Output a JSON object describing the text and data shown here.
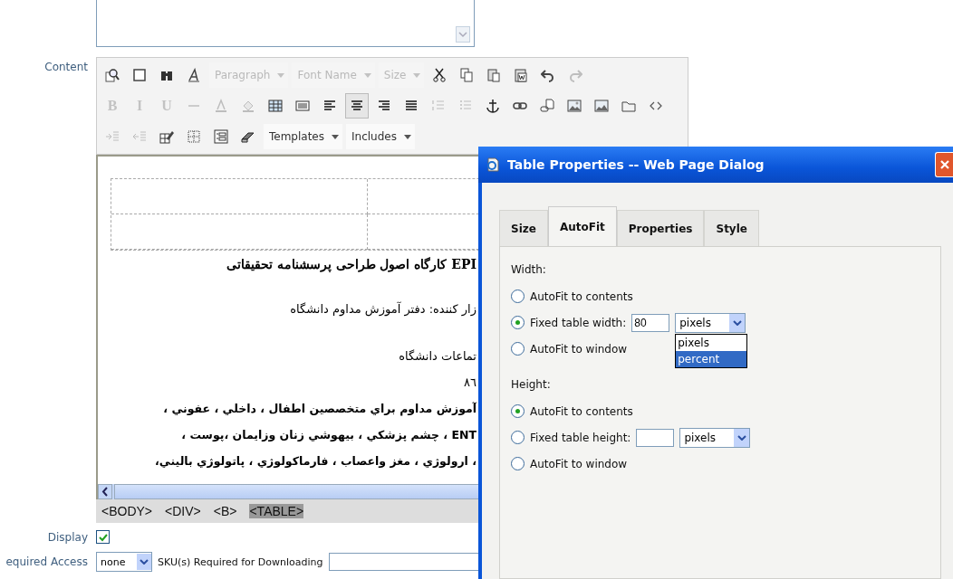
{
  "content_label": "Content",
  "toolbar": {
    "rows": [
      {
        "items": [
          {
            "kind": "button",
            "disabled": false
          },
          {
            "kind": "button",
            "disabled": false
          },
          {
            "kind": "button",
            "disabled": false
          },
          {
            "kind": "button",
            "disabled": false
          },
          {
            "kind": "dropdown",
            "label": "Paragraph",
            "disabled": true
          },
          {
            "kind": "dropdown",
            "label": "Font Name",
            "disabled": true
          },
          {
            "kind": "dropdown",
            "label": "Size",
            "disabled": true
          },
          {
            "kind": "button",
            "disabled": false
          },
          {
            "kind": "button",
            "disabled": false
          },
          {
            "kind": "button",
            "disabled": false
          },
          {
            "kind": "button",
            "disabled": false
          },
          {
            "kind": "button",
            "disabled": false
          },
          {
            "kind": "button",
            "disabled": true
          }
        ]
      },
      {
        "items": [
          {
            "kind": "letter",
            "label": "B",
            "disabled": true,
            "selected": false
          },
          {
            "kind": "letter",
            "label": "I",
            "disabled": true,
            "selected": false
          },
          {
            "kind": "letter",
            "label": "U",
            "disabled": true,
            "selected": false
          },
          {
            "kind": "button",
            "disabled": true,
            "selected": false
          },
          {
            "kind": "button",
            "disabled": true,
            "selected": false
          },
          {
            "kind": "button",
            "disabled": true,
            "selected": false
          },
          {
            "kind": "button",
            "disabled": false,
            "selected": false
          },
          {
            "kind": "button",
            "disabled": false,
            "selected": false
          },
          {
            "kind": "button",
            "disabled": false,
            "selected": false
          },
          {
            "kind": "button",
            "disabled": false,
            "selected": true
          },
          {
            "kind": "button",
            "disabled": false,
            "selected": false
          },
          {
            "kind": "button",
            "disabled": false,
            "selected": false
          },
          {
            "kind": "button",
            "disabled": true,
            "selected": false
          },
          {
            "kind": "button",
            "disabled": true,
            "selected": false
          },
          {
            "kind": "button",
            "disabled": false,
            "selected": false
          },
          {
            "kind": "button",
            "disabled": false,
            "selected": false
          },
          {
            "kind": "button",
            "disabled": false,
            "selected": false
          },
          {
            "kind": "button",
            "disabled": false,
            "selected": false
          },
          {
            "kind": "button",
            "disabled": false,
            "selected": false
          },
          {
            "kind": "button",
            "disabled": false,
            "selected": false
          },
          {
            "kind": "button",
            "disabled": false,
            "selected": false
          }
        ]
      },
      {
        "items": [
          {
            "kind": "button",
            "disabled": true
          },
          {
            "kind": "button",
            "disabled": true
          },
          {
            "kind": "button",
            "disabled": false
          },
          {
            "kind": "button",
            "disabled": false
          },
          {
            "kind": "button",
            "disabled": false
          },
          {
            "kind": "button",
            "disabled": false
          },
          {
            "kind": "dropdown",
            "label": "Templates",
            "disabled": false
          },
          {
            "kind": "dropdown",
            "label": "Includes",
            "disabled": false
          }
        ]
      }
    ]
  },
  "editor": {
    "lines": [
      {
        "text": "EPI کارگاه اصول طراحی پرسشنامه تحقیقاتی",
        "bold": false,
        "kind": "heading"
      },
      {
        "text": "زار کننده: دفتر آموزش مداوم دانشگاه",
        "bold": false,
        "kind": "para"
      },
      {
        "text": "تماعات دانشگاه",
        "bold": false,
        "kind": "tight"
      },
      {
        "text": "٨٦",
        "bold": false,
        "kind": "tight"
      },
      {
        "text": "آموزش مداوم براي متخصصين اطفال ، داخلي ، عفوني ،",
        "bold": true,
        "kind": "tight"
      },
      {
        "text": "ENT ، چشم پزشكي ، بيهوشي زنان وزايمان ،پوست ،",
        "bold": true,
        "kind": "tight"
      },
      {
        "text": "، ارولوژي ، مغز واعصاب ، فارماكولوژي ، پاتولوژي باليني،",
        "bold": true,
        "kind": "tight"
      }
    ]
  },
  "path_bar": [
    {
      "label": "<BODY>",
      "selected": false
    },
    {
      "label": "<DIV>",
      "selected": false
    },
    {
      "label": "<B>",
      "selected": false
    },
    {
      "label": "<TABLE>",
      "selected": true
    }
  ],
  "display": {
    "label": "Display",
    "checked": true
  },
  "access": {
    "label": "equired Access",
    "select": "none",
    "sku_label": "SKU(s) Required for Downloading"
  },
  "dialog": {
    "title": "Table Properties -- Web Page Dialog",
    "tabs": [
      {
        "label": "Size",
        "selected": false
      },
      {
        "label": "AutoFit",
        "selected": true
      },
      {
        "label": "Properties",
        "selected": false
      },
      {
        "label": "Style",
        "selected": false
      }
    ],
    "width": {
      "heading": "Width:",
      "options": [
        {
          "label": "AutoFit to contents",
          "selected": false
        },
        {
          "label": "Fixed table width:",
          "selected": true,
          "value": "80",
          "unit": "pixels"
        },
        {
          "label": "AutoFit to window",
          "selected": false
        }
      ],
      "unit_menu": [
        {
          "label": "pixels",
          "selected": false
        },
        {
          "label": "percent",
          "selected": true
        }
      ]
    },
    "height": {
      "heading": "Height:",
      "options": [
        {
          "label": "AutoFit to contents",
          "selected": true
        },
        {
          "label": "Fixed table height:",
          "selected": false,
          "unit": "pixels"
        },
        {
          "label": "AutoFit to window",
          "selected": false
        }
      ]
    }
  }
}
